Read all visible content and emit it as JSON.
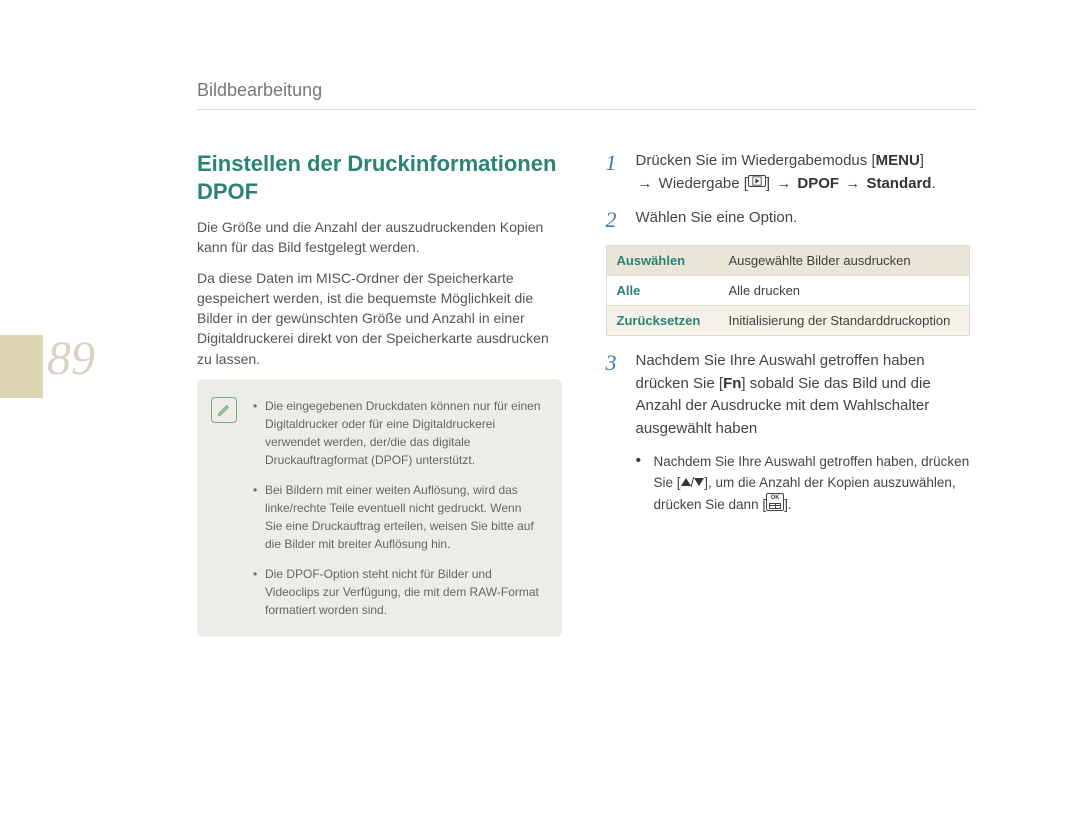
{
  "page_number": "89",
  "breadcrumb": "Bildbearbeitung",
  "left": {
    "heading_line1": "Einstellen der Druckinformationen",
    "heading_line2": "DPOF",
    "para1": "Die Größe und die Anzahl der auszudruckenden Kopien kann für das Bild festgelegt werden.",
    "para2": "Da diese Daten im MISC-Ordner der Speicherkarte gespeichert werden, ist die bequemste Möglichkeit die Bilder in der gewünschten Größe und Anzahl in einer Digitaldruckerei direkt von der Speicherkarte ausdrucken zu lassen.",
    "note_icon": "note-pencil-icon",
    "notes": [
      "Die eingegebenen Druckdaten können nur für einen Digitaldrucker oder für eine Digitaldruckerei verwendet werden, der/die das digitale Druckauftragformat (DPOF) unterstützt.",
      "Bei Bildern mit einer weiten Auﬂösung, wird das linke/rechte Teile eventuell nicht gedruckt. Wenn Sie eine Druckauftrag erteilen, weisen Sie bitte auf die Bilder mit breiter Auﬂösung hin.",
      "Die DPOF-Option steht nicht für Bilder und Videoclips zur Verfügung, die mit dem RAW-Format formatiert worden sind."
    ]
  },
  "right": {
    "step1": {
      "num": "1",
      "pre": "Drücken Sie im Wiedergabemodus ",
      "menu": "MENU",
      "mid1": " Wiedergabe ",
      "play_icon": "play-icon",
      "dpof": "DPOF",
      "std": "Standard",
      "arrow": "→"
    },
    "step2": {
      "num": "2",
      "text": "Wählen Sie eine Option."
    },
    "table": [
      {
        "k": "Auswählen",
        "v": "Ausgewählte Bilder ausdrucken"
      },
      {
        "k": "Alle",
        "v": "Alle drucken"
      },
      {
        "k": "Zurücksetzen",
        "v": "Initialisierung der Standarddruckoption"
      }
    ],
    "step3": {
      "num": "3",
      "line1": "Nachdem Sie Ihre Auswahl getroffen haben drücken Sie ",
      "fn": "Fn",
      "line2": " sobald Sie das Bild und die Anzahl der Ausdrucke mit dem Wahlschalter ausgewählt haben"
    },
    "sub": {
      "pre": "Nachdem Sie Ihre Auswahl getroffen haben, drücken Sie [",
      "up_icon": "triangle-up-icon",
      "sep": "/",
      "down_icon": "triangle-down-icon",
      "mid": "], um die Anzahl der Kopien auszuwählen, drücken Sie dann [",
      "ok_icon": "ok-grid-icon",
      "post": "]."
    }
  }
}
